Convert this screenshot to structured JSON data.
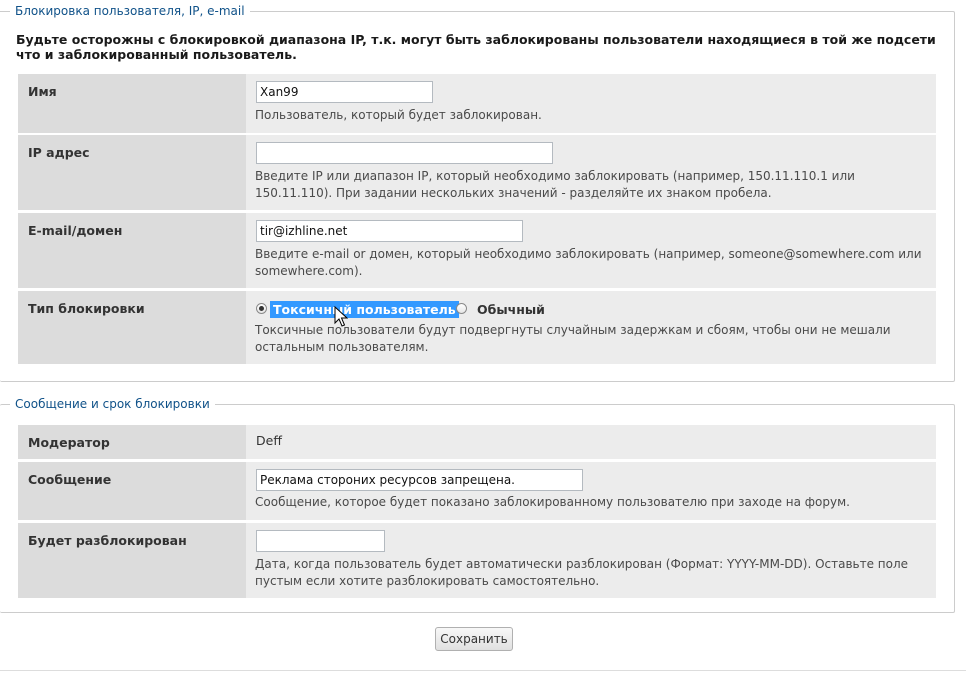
{
  "ban_section": {
    "legend": "Блокировка пользователя, IP, e-mail",
    "warning": "Будьте осторожны с блокировкой диапазона IP, т.к. могут быть заблокированы пользователи находящиеся в той же подсети что и заблокированный пользователь.",
    "name": {
      "label": "Имя",
      "value": "Xan99",
      "hint": "Пользователь, который будет заблокирован."
    },
    "ip": {
      "label": "IP адрес",
      "value": "",
      "hint": "Введите IP или диапазон IP, который необходимо заблокировать (например, 150.11.110.1 или 150.11.110). При задании нескольких значений - разделяйте их знаком пробела."
    },
    "email": {
      "label": "E-mail/домен",
      "value": "tir@izhline.net",
      "hint": "Введите e-mail or домен, который необходимо заблокировать (например, someone@somewhere.com или somewhere.com)."
    },
    "ban_type": {
      "label": "Тип блокировки",
      "option_toxic": "Токсичный пользователь",
      "option_normal": "Обычный",
      "selected": "option_toxic",
      "hint": "Токсичные пользователи будут подвергнуты случайным задержкам и сбоям, чтобы они не мешали остальным пользователям."
    }
  },
  "message_section": {
    "legend": "Сообщение и срок блокировки",
    "moderator": {
      "label": "Модератор",
      "value": "Deff"
    },
    "message": {
      "label": "Сообщение",
      "value": "Реклама стороних ресурсов запрещена.",
      "hint": "Сообщение, которое будет показано заблокированному пользователю при заходе на форум."
    },
    "unban": {
      "label": "Будет разблокирован",
      "value": "",
      "hint": "Дата, когда пользователь будет автоматически разблокирован (Формат: YYYY-MM-DD). Оставьте поле пустым если хотите разблокировать самостоятельно."
    }
  },
  "actions": {
    "save_label": "Сохранить"
  }
}
